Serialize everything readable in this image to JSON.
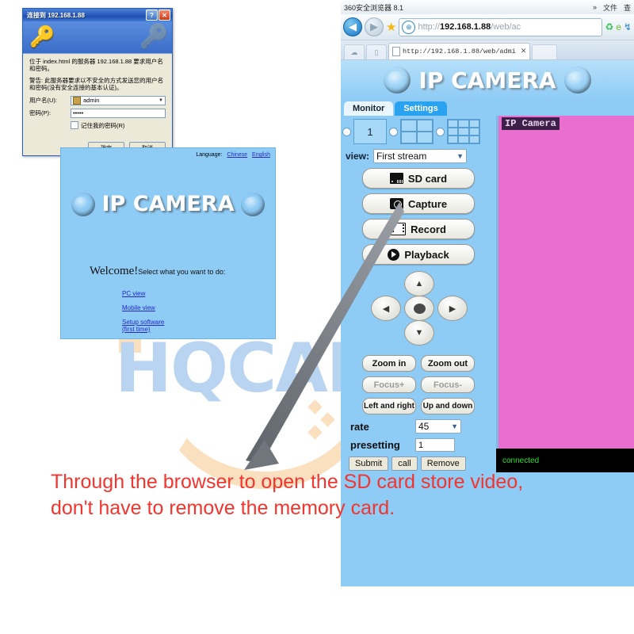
{
  "auth_dialog": {
    "title": "连接到 192.168.1.88",
    "help_btn": "?",
    "close_btn": "✕",
    "body_line1": "位于 index.html 的服务器 192.168.1.88 要求用户名和密码。",
    "body_line2": "警告: 此服务器要求以不安全的方式发送您的用户名和密码(没有安全连接的基本认证)。",
    "username_label": "用户名(U):",
    "username_value": "admin",
    "password_label": "密码(P):",
    "password_value": "•••••",
    "remember_label": "记住我的密码(R)",
    "ok_button": "确定",
    "cancel_button": "取消"
  },
  "welcome_panel": {
    "language_label": "Language:",
    "lang_chinese": "Chinese",
    "lang_english": "English",
    "brand": "IP CAMERA",
    "welcome_word": "Welcome!",
    "welcome_rest": "Select what you want to do:",
    "link_pc_view": "PC view",
    "link_mobile_view": "Mobile view",
    "link_setup": "Setup software",
    "link_setup_note": "(first time)"
  },
  "browser": {
    "app_title": "360安全浏览器 8.1",
    "menu_more": "»",
    "menu_file": "文件",
    "menu_extra": "查",
    "url_scheme": "http://",
    "url_host": "192.168.1.88",
    "url_path": "/web/ac",
    "shield_icon": "⊕",
    "back_icon": "◀",
    "forward_icon": "▶",
    "star_icon": "★",
    "refresh_icon": "♻",
    "compat_icon": "e",
    "speed_icon": "↯",
    "tab_title": "http://192.168.1.88/web/admi",
    "tab_close": "✕",
    "cloud_icon": "☁",
    "phone_icon": "▯"
  },
  "ipcam_page": {
    "brand": "IP CAMERA",
    "tab_monitor": "Monitor",
    "tab_settings": "Settings",
    "video_label": "IP Camera",
    "status": "connected",
    "stream_count": "1",
    "view_label": "view:",
    "view_value": "First stream",
    "btn_sdcard": "SD card",
    "btn_capture": "Capture",
    "btn_record": "Record",
    "btn_playback": "Playback",
    "dpad_up": "▲",
    "dpad_down": "▼",
    "dpad_left": "◀",
    "dpad_right": "▶",
    "btn_zoom_in": "Zoom in",
    "btn_zoom_out": "Zoom out",
    "btn_focus_plus": "Focus+",
    "btn_focus_minus": "Focus-",
    "btn_left_right": "Left and right",
    "btn_up_down": "Up and down",
    "rate_label": "rate",
    "rate_value": "45",
    "presetting_label": "presetting",
    "presetting_value": "1",
    "btn_submit": "Submit",
    "btn_call": "call",
    "btn_remove": "Remove"
  },
  "annotation": {
    "caption_line1": "Through the browser to open the SD card store video,",
    "caption_line2": "don't have to remove the memory card.",
    "caption_color": "#f2352e"
  },
  "watermark": {
    "text": "HQCAM"
  }
}
